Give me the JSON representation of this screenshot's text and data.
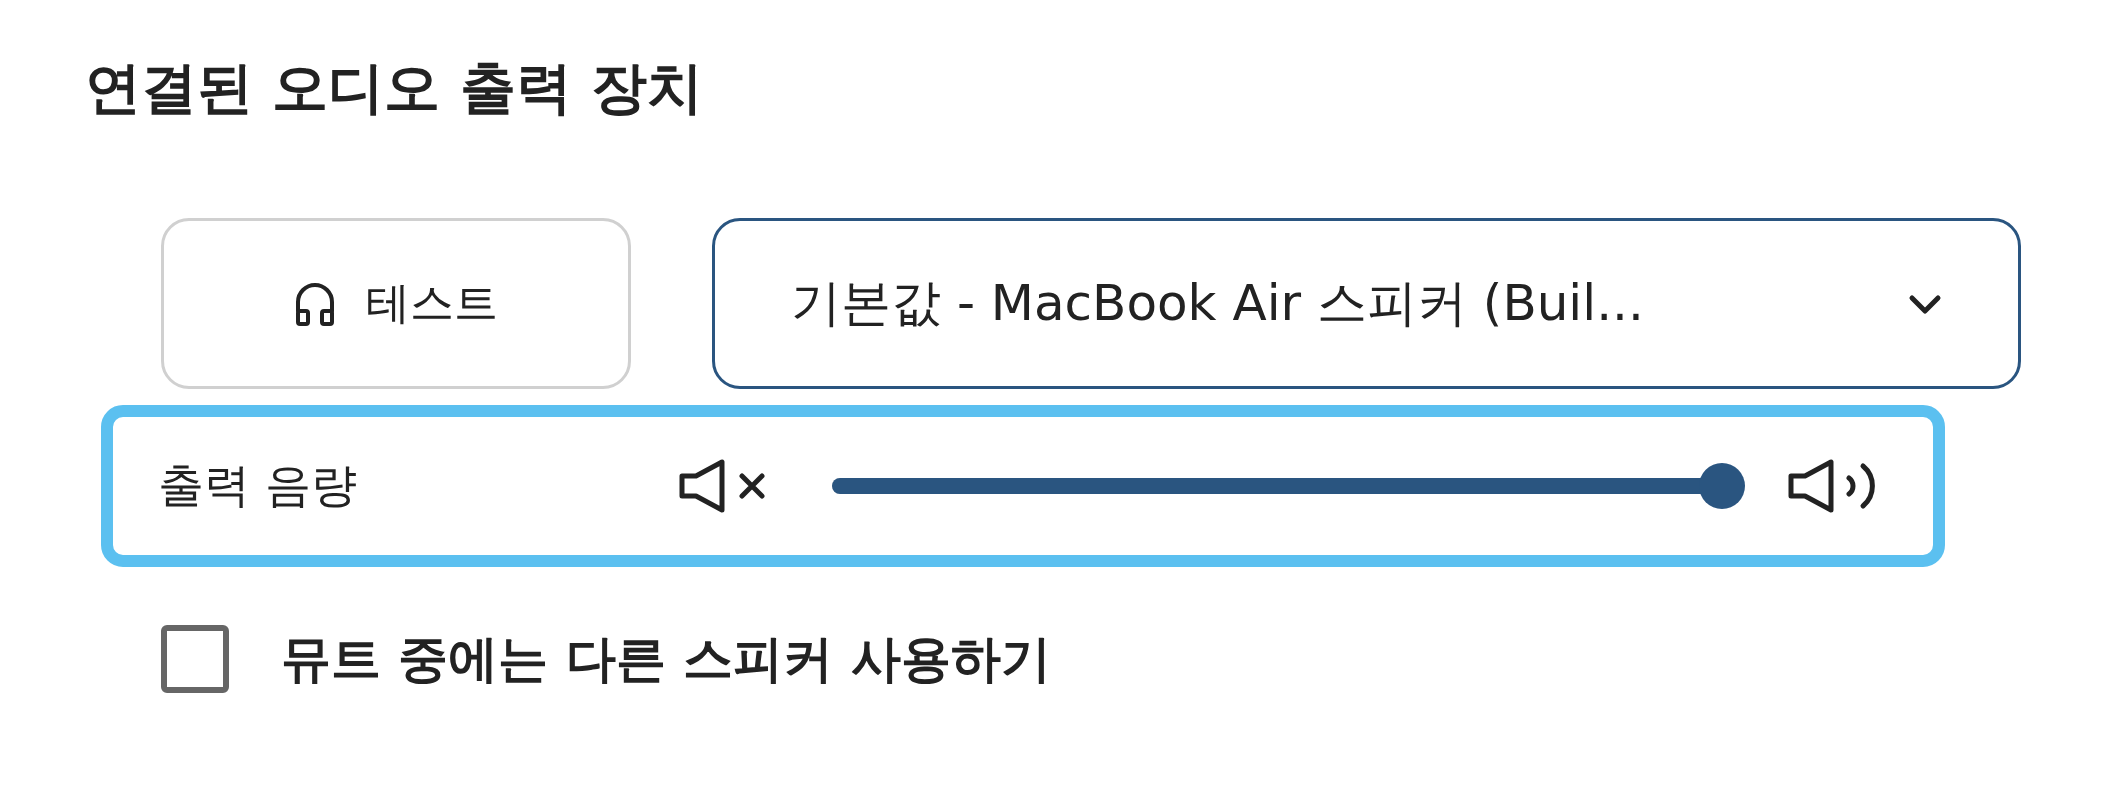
{
  "title": "연결된 오디오 출력 장치",
  "test_button": {
    "label": "테스트"
  },
  "output_select": {
    "value": "기본값 - MacBook Air 스피커 (Buil..."
  },
  "volume": {
    "label": "출력 음량",
    "level": 1.0,
    "focused": true
  },
  "mute_fallback": {
    "label": "뮤트 중에는 다른 스피커 사용하기",
    "checked": false
  }
}
